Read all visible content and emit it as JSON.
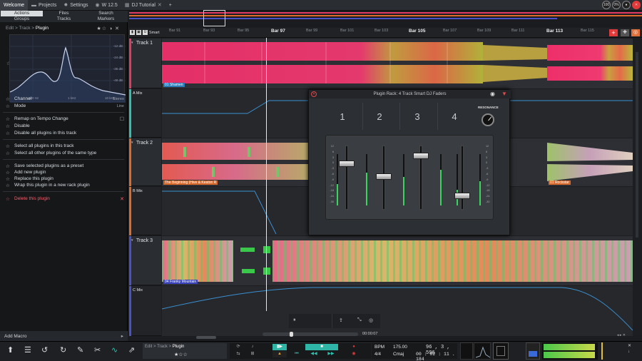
{
  "tabs": {
    "welcome": "Welcome",
    "projects": "Projects",
    "settings": "Settings",
    "version": "W 12.5",
    "project": "DJ Tutorial",
    "add": "+"
  },
  "topright": {
    "zoom": "100",
    "cpu": "0%"
  },
  "panel_tabs": {
    "actions": "Actions",
    "groups": "Groups",
    "files": "Files",
    "tracks": "Tracks",
    "search": "Search",
    "markers": "Markers"
  },
  "crumb": {
    "path": "Edit > Track >",
    "current": "Plugin"
  },
  "eq": {
    "db": [
      "-12 dB",
      "-24 dB",
      "-36 dB",
      "-48 dB"
    ],
    "freq": [
      "100 Hz",
      "1 kHz",
      "10 kHz"
    ]
  },
  "menu": {
    "channel": "Channel",
    "channel_val": "Stereo",
    "mode": "Mode",
    "mode_val": "Line",
    "remap": "Remap on Tempo Change",
    "disable": "Disable",
    "disable_all": "Disable all plugins in this track",
    "select_all": "Select all plugins in this track",
    "select_other": "Select all other plugins of the same type",
    "save_preset": "Save selected plugins as a preset",
    "add_new": "Add new plugin",
    "replace": "Replace this plugin",
    "wrap": "Wrap this plugin in a new rack plugin",
    "delete": "Delete this plugin"
  },
  "add_macro": "Add Macro",
  "smart": "Smart",
  "ruler": {
    "bars": [
      "Bar 91",
      "Bar 93",
      "Bar 95",
      "Bar 97",
      "Bar 99",
      "Bar 101",
      "Bar 103",
      "Bar 105",
      "Bar 107",
      "Bar 109",
      "Bar 111",
      "Bar 113",
      "Bar 115"
    ]
  },
  "tracks": {
    "t1": "Track 1",
    "amix": "A Mix",
    "t2": "Track 2",
    "bmix": "B Mix",
    "t3": "Track 3",
    "cmix": "C Mix"
  },
  "clips": {
    "c1": "01 Shamen",
    "c2": "The Beginning (Hive & Keaton R",
    "c3": "01 Rockstar",
    "c4": "04 Franky Mountain"
  },
  "rack": {
    "title": "Plugin Rack: 4 Track Smart DJ Faders",
    "ch": [
      "1",
      "2",
      "3",
      "4"
    ],
    "resonance": "RESONANCE",
    "scale": [
      "12",
      "6",
      "3",
      "0",
      "-3",
      "-6",
      "-9",
      "-12",
      "-18",
      "-24",
      "-30"
    ]
  },
  "faders": [
    0.26,
    0.48,
    0.12,
    0.82
  ],
  "timeline": {
    "time": "00:00:07"
  },
  "status": {
    "crumb_path": "Edit > Track >",
    "crumb_cur": "Plugin",
    "bpm_label": "BPM",
    "bpm": "175.00",
    "position": "96 , 3 , 596",
    "sig": "4/4",
    "key": "Cmaj",
    "time": "00 : 02 : 11 . 184"
  },
  "colors": {
    "accent": "#2fb5a6",
    "delete": "#ff5a6a",
    "track1": "#e23a62",
    "teal": "#2fc0b0"
  }
}
